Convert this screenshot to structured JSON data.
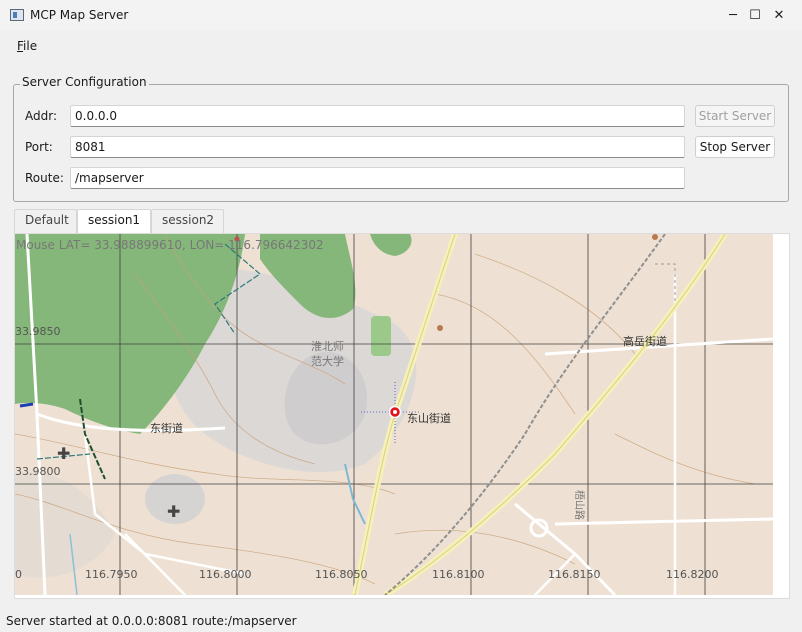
{
  "window": {
    "title": "MCP Map Server",
    "minimize_glyph": "─",
    "maximize_glyph": "☐",
    "close_glyph": "✕"
  },
  "menu": {
    "file_accel": "F",
    "file_rest": "ile"
  },
  "config": {
    "group_title": "Server Configuration",
    "addr_label": "Addr:",
    "addr_value": "0.0.0.0",
    "port_label": "Port:",
    "port_value": "8081",
    "route_label": "Route:",
    "route_value": "/mapserver",
    "start_label": "Start Server",
    "stop_label": "Stop Server"
  },
  "tabs": [
    {
      "label": "Default",
      "active": false
    },
    {
      "label": "session1",
      "active": true
    },
    {
      "label": "session2",
      "active": false
    }
  ],
  "map": {
    "mouse_readout": "Mouse LAT=  33.988899610, LON= 116.796642302",
    "lat_labels": [
      "33.9850",
      "33.9800"
    ],
    "lon_labels": [
      "0",
      "116.7950",
      "116.8000",
      "116.8050",
      "116.8100",
      "116.8150",
      "116.8200"
    ],
    "place_labels": {
      "university_line1": "淮北师",
      "university_line2": "范大学",
      "gaoyue": "高岳街道",
      "dongshan": "东山街道",
      "dongjie": "东街道",
      "road_vertical": "梧山路"
    },
    "marker_color": "#e3141c",
    "grid_color": "#404040"
  },
  "status": {
    "text": "Server started at 0.0.0.0:8081 route:/mapserver"
  }
}
